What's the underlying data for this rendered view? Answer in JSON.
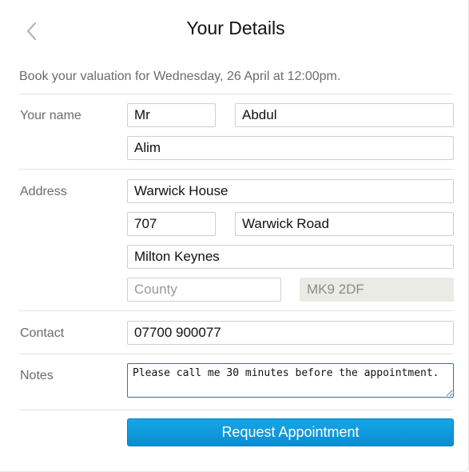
{
  "header": {
    "title": "Your Details",
    "back_icon": "chevron-left-icon"
  },
  "booking": {
    "summary": "Book your valuation for Wednesday, 26 April at 12:00pm."
  },
  "name": {
    "label": "Your name",
    "title_value": "Mr",
    "first_name_value": "Abdul",
    "last_name_value": "Alim"
  },
  "address": {
    "label": "Address",
    "line1_value": "Warwick House",
    "number_value": "707",
    "street_value": "Warwick Road",
    "town_value": "Milton Keynes",
    "county_value": "",
    "county_placeholder": "County",
    "postcode_value": "MK9 2DF"
  },
  "contact": {
    "label": "Contact",
    "phone_value": "07700 900077"
  },
  "notes": {
    "label": "Notes",
    "value": "Please call me 30 minutes before the appointment. "
  },
  "actions": {
    "submit_label": "Request Appointment"
  },
  "colors": {
    "accent": "#0a8dd1",
    "focus_border": "#2f6fc4",
    "label_text": "#6b6b6b",
    "readonly_bg": "#ebebe6"
  }
}
